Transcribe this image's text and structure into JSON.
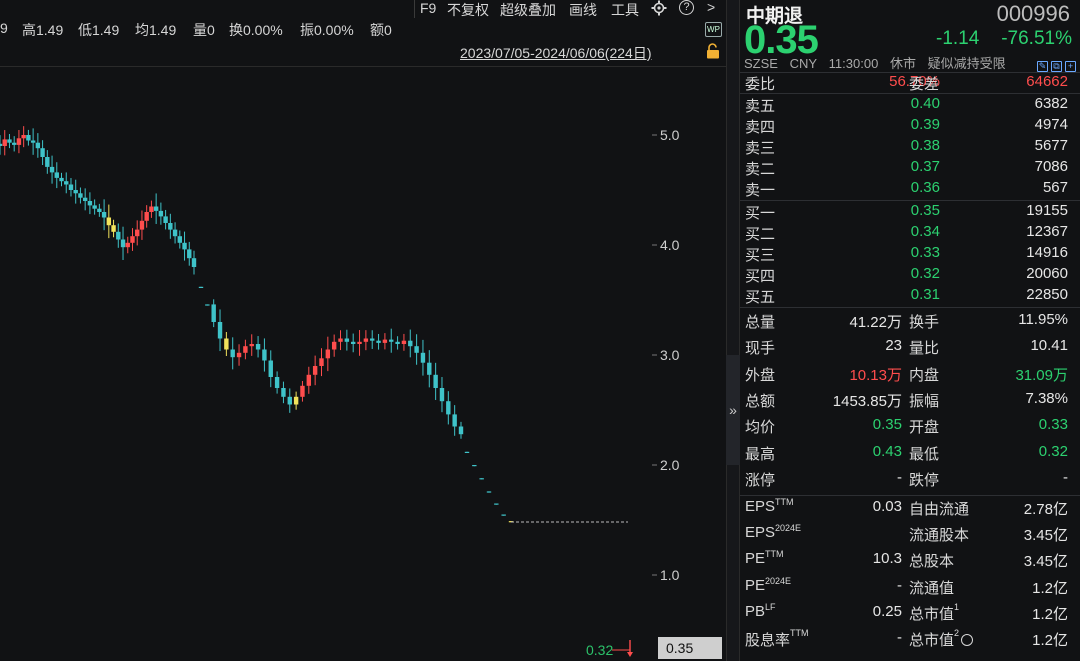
{
  "toolbar": {
    "stats": [
      {
        "label": "9",
        "name": "stat-open"
      },
      {
        "label": "高1.49",
        "name": "stat-high"
      },
      {
        "label": "低1.49",
        "name": "stat-low"
      },
      {
        "label": "均1.49",
        "name": "stat-avg"
      },
      {
        "label": "量0",
        "name": "stat-volume"
      },
      {
        "label": "换0.00%",
        "name": "stat-turnover"
      },
      {
        "label": "振0.00%",
        "name": "stat-amplitude"
      },
      {
        "label": "额0",
        "name": "stat-amount"
      }
    ],
    "tools": [
      "F9",
      "不复权",
      "超级叠加",
      "画线",
      "工具"
    ],
    "help_glyph": "?",
    "more_glyph": ">",
    "wp_label": "WP",
    "date_range": "2023/07/05-2024/06/06(224日)"
  },
  "axis": {
    "ticks": [
      {
        "value": 5.0,
        "label": "5.0"
      },
      {
        "value": 4.0,
        "label": "4.0"
      },
      {
        "value": 3.0,
        "label": "3.0"
      },
      {
        "value": 2.0,
        "label": "2.0"
      },
      {
        "value": 1.0,
        "label": "1.0"
      }
    ],
    "last_price_label": "0.35",
    "last_close_label": "0.32"
  },
  "colors": {
    "up": "#ff4d4d",
    "down": "#3fc3c9",
    "highlight": "#f2e35c",
    "price_green": "#2cd170",
    "background": "#111214"
  },
  "chart_data": {
    "type": "candlestick",
    "ylim": [
      0.3,
      6.0
    ],
    "grid": false,
    "x_range_label": "2023/07/05-2024/06/06(224日)",
    "series": [
      {
        "values": [
          4.9,
          4.96,
          4.93,
          4.91,
          4.97,
          5.0,
          4.95,
          4.93,
          4.88,
          4.8,
          4.71,
          4.66,
          4.61,
          4.58,
          4.55,
          4.5,
          4.47,
          4.43,
          4.4,
          4.36,
          4.33,
          4.3,
          4.25,
          4.18,
          4.12,
          4.05,
          3.98,
          4.02,
          4.08,
          4.14,
          4.22,
          4.3,
          4.35,
          4.31,
          4.26,
          4.2,
          4.14,
          4.08,
          4.02,
          3.96,
          3.88,
          3.8
        ]
      },
      {
        "values": [
          3.62,
          3.46,
          3.3,
          3.15,
          3.05,
          2.98,
          3.02,
          3.08,
          3.1,
          3.05,
          2.95,
          2.8,
          2.7,
          2.62,
          2.55,
          2.62,
          2.72,
          2.82,
          2.9,
          2.97,
          3.05,
          3.12,
          3.15,
          3.12,
          3.1,
          3.12,
          3.15,
          3.13,
          3.11,
          3.14,
          3.12,
          3.1,
          3.13,
          3.08,
          3.02,
          2.93,
          2.82,
          2.7,
          2.58,
          2.46,
          2.35,
          2.28
        ]
      },
      {
        "values": [
          2.12,
          2.0,
          1.88,
          1.76,
          1.65,
          1.55,
          1.49
        ]
      }
    ],
    "last_price": 0.35
  },
  "quote": {
    "name": "中期退",
    "code": "000996",
    "price": "0.35",
    "change": "-1.14",
    "change_pct": "-76.51%",
    "meta": [
      "SZSE",
      "CNY",
      "11:30:00",
      "休市",
      "疑似减持受限"
    ],
    "panel_icons": [
      "✎",
      "⧉",
      "+"
    ],
    "webi_label": "委比",
    "webi_value": "56.70%",
    "weicha_label": "委差",
    "weicha_value": "64662",
    "asks": [
      {
        "label": "卖五",
        "price": "0.40",
        "vol": "6382"
      },
      {
        "label": "卖四",
        "price": "0.39",
        "vol": "4974"
      },
      {
        "label": "卖三",
        "price": "0.38",
        "vol": "5677"
      },
      {
        "label": "卖二",
        "price": "0.37",
        "vol": "7086"
      },
      {
        "label": "卖一",
        "price": "0.36",
        "vol": "567"
      }
    ],
    "bids": [
      {
        "label": "买一",
        "price": "0.35",
        "vol": "19155"
      },
      {
        "label": "买二",
        "price": "0.34",
        "vol": "12367"
      },
      {
        "label": "买三",
        "price": "0.33",
        "vol": "14916"
      },
      {
        "label": "买四",
        "price": "0.32",
        "vol": "20060"
      },
      {
        "label": "买五",
        "price": "0.31",
        "vol": "22850"
      }
    ],
    "stats1": [
      {
        "l1": "总量",
        "v1": "41.22万",
        "l2": "换手",
        "v2": "11.95%"
      },
      {
        "l1": "现手",
        "v1": "23",
        "l2": "量比",
        "v2": "10.41"
      },
      {
        "l1": "外盘",
        "v1": "10.13万",
        "l2": "内盘",
        "v2": "31.09万"
      },
      {
        "l1": "总额",
        "v1": "1453.85万",
        "l2": "振幅",
        "v2": "7.38%"
      },
      {
        "l1": "均价",
        "v1": "0.35",
        "l2": "开盘",
        "v2": "0.33"
      },
      {
        "l1": "最高",
        "v1": "0.43",
        "l2": "最低",
        "v2": "0.32"
      },
      {
        "l1": "涨停",
        "v1": "-",
        "l2": "跌停",
        "v2": "-"
      }
    ],
    "stats2": [
      {
        "l1": "EPS",
        "sup1": "TTM",
        "v1": "0.03",
        "l2": "自由流通",
        "sup2": "",
        "v2": "2.78亿"
      },
      {
        "l1": "EPS",
        "sup1": "2024E",
        "v1": "",
        "l2": "流通股本",
        "sup2": "",
        "v2": "3.45亿"
      },
      {
        "l1": "PE",
        "sup1": "TTM",
        "v1": "10.3",
        "l2": "总股本",
        "sup2": "",
        "v2": "3.45亿"
      },
      {
        "l1": "PE",
        "sup1": "2024E",
        "v1": "-",
        "l2": "流通值",
        "sup2": "",
        "v2": "1.2亿"
      },
      {
        "l1": "PB",
        "sup1": "LF",
        "v1": "0.25",
        "l2": "总市值",
        "sup2": "1",
        "v2": "1.2亿"
      },
      {
        "l1": "股息率",
        "sup1": "TTM",
        "v1": "-",
        "l2": "总市值",
        "sup2": "2",
        "v2": "1.2亿"
      }
    ],
    "collapse_glyph": "»"
  }
}
